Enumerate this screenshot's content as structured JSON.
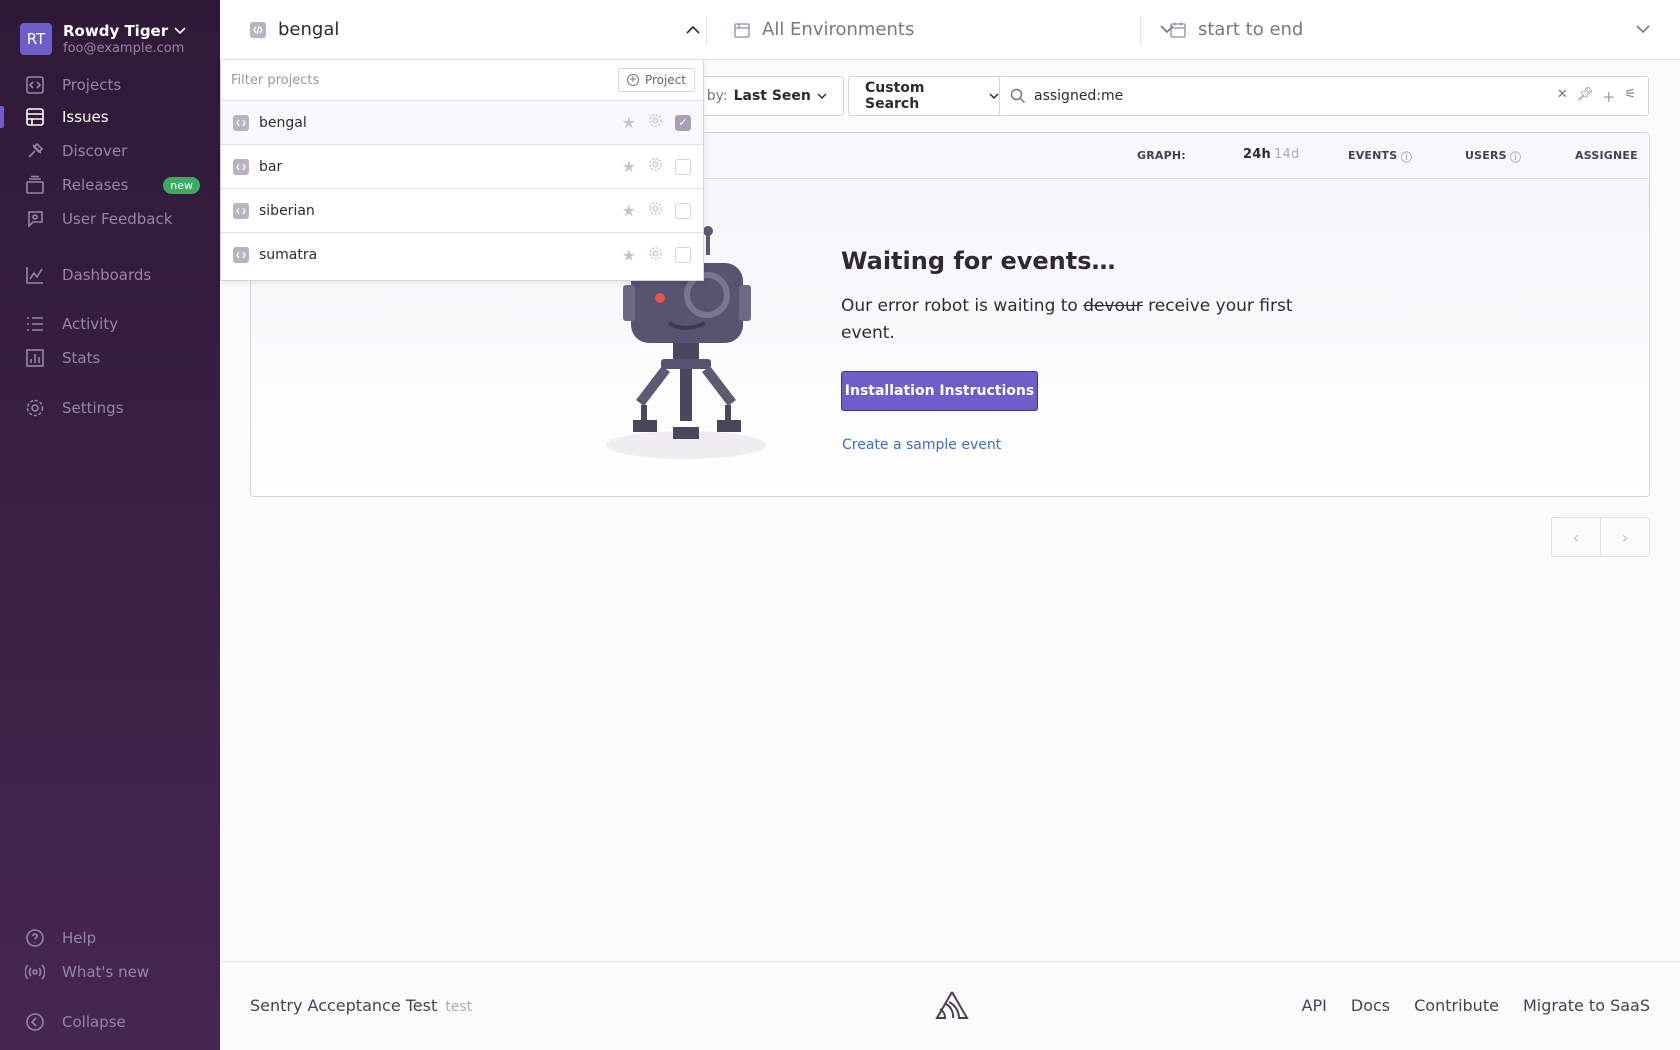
{
  "org": {
    "initials": "RT",
    "name": "Rowdy Tiger",
    "email": "foo@example.com"
  },
  "sidebar": {
    "items": [
      {
        "label": "Projects",
        "icon": "projects-icon"
      },
      {
        "label": "Issues",
        "icon": "issues-icon",
        "active": true
      },
      {
        "label": "Discover",
        "icon": "discover-icon"
      },
      {
        "label": "Releases",
        "icon": "releases-icon",
        "badge": "new"
      },
      {
        "label": "User Feedback",
        "icon": "user-feedback-icon"
      },
      {
        "label": "Dashboards",
        "icon": "dashboards-icon"
      },
      {
        "label": "Activity",
        "icon": "activity-icon"
      },
      {
        "label": "Stats",
        "icon": "stats-icon"
      },
      {
        "label": "Settings",
        "icon": "settings-icon"
      }
    ],
    "bottom": [
      {
        "label": "Help",
        "icon": "help-icon"
      },
      {
        "label": "What's new",
        "icon": "broadcast-icon"
      },
      {
        "label": "Collapse",
        "icon": "collapse-icon"
      }
    ]
  },
  "header": {
    "project": "bengal",
    "environment": "All Environments",
    "date_range": "start to end"
  },
  "toolbar": {
    "sort_prefix": "rt by:",
    "sort_value": "Last Seen",
    "saved_search": "Custom Search",
    "search_value": "assigned:me"
  },
  "table": {
    "graph_label": "GRAPH:",
    "graph_24h": "24h",
    "graph_14d": "14d",
    "events": "EVENTS",
    "users": "USERS",
    "assignee": "ASSIGNEE"
  },
  "empty_state": {
    "title": "Waiting for events…",
    "text_before": "Our error robot is waiting to ",
    "text_struck": "devour",
    "text_after": " receive your first event.",
    "button": "Installation Instructions",
    "link": "Create a sample event"
  },
  "dropdown": {
    "filter_placeholder": "Filter projects",
    "add_button": "Project",
    "projects": [
      {
        "name": "bengal",
        "selected": true
      },
      {
        "name": "bar",
        "selected": false
      },
      {
        "name": "siberian",
        "selected": false
      },
      {
        "name": "sumatra",
        "selected": false
      }
    ]
  },
  "footer": {
    "title": "Sentry Acceptance Test",
    "tag": "test",
    "links": [
      "API",
      "Docs",
      "Contribute",
      "Migrate to SaaS"
    ]
  },
  "colors": {
    "accent": "#6c5fc7",
    "sidebar_top": "#2f1937",
    "sidebar_bottom": "#452650",
    "link": "#3b6ecc",
    "badge": "#3fa862"
  }
}
